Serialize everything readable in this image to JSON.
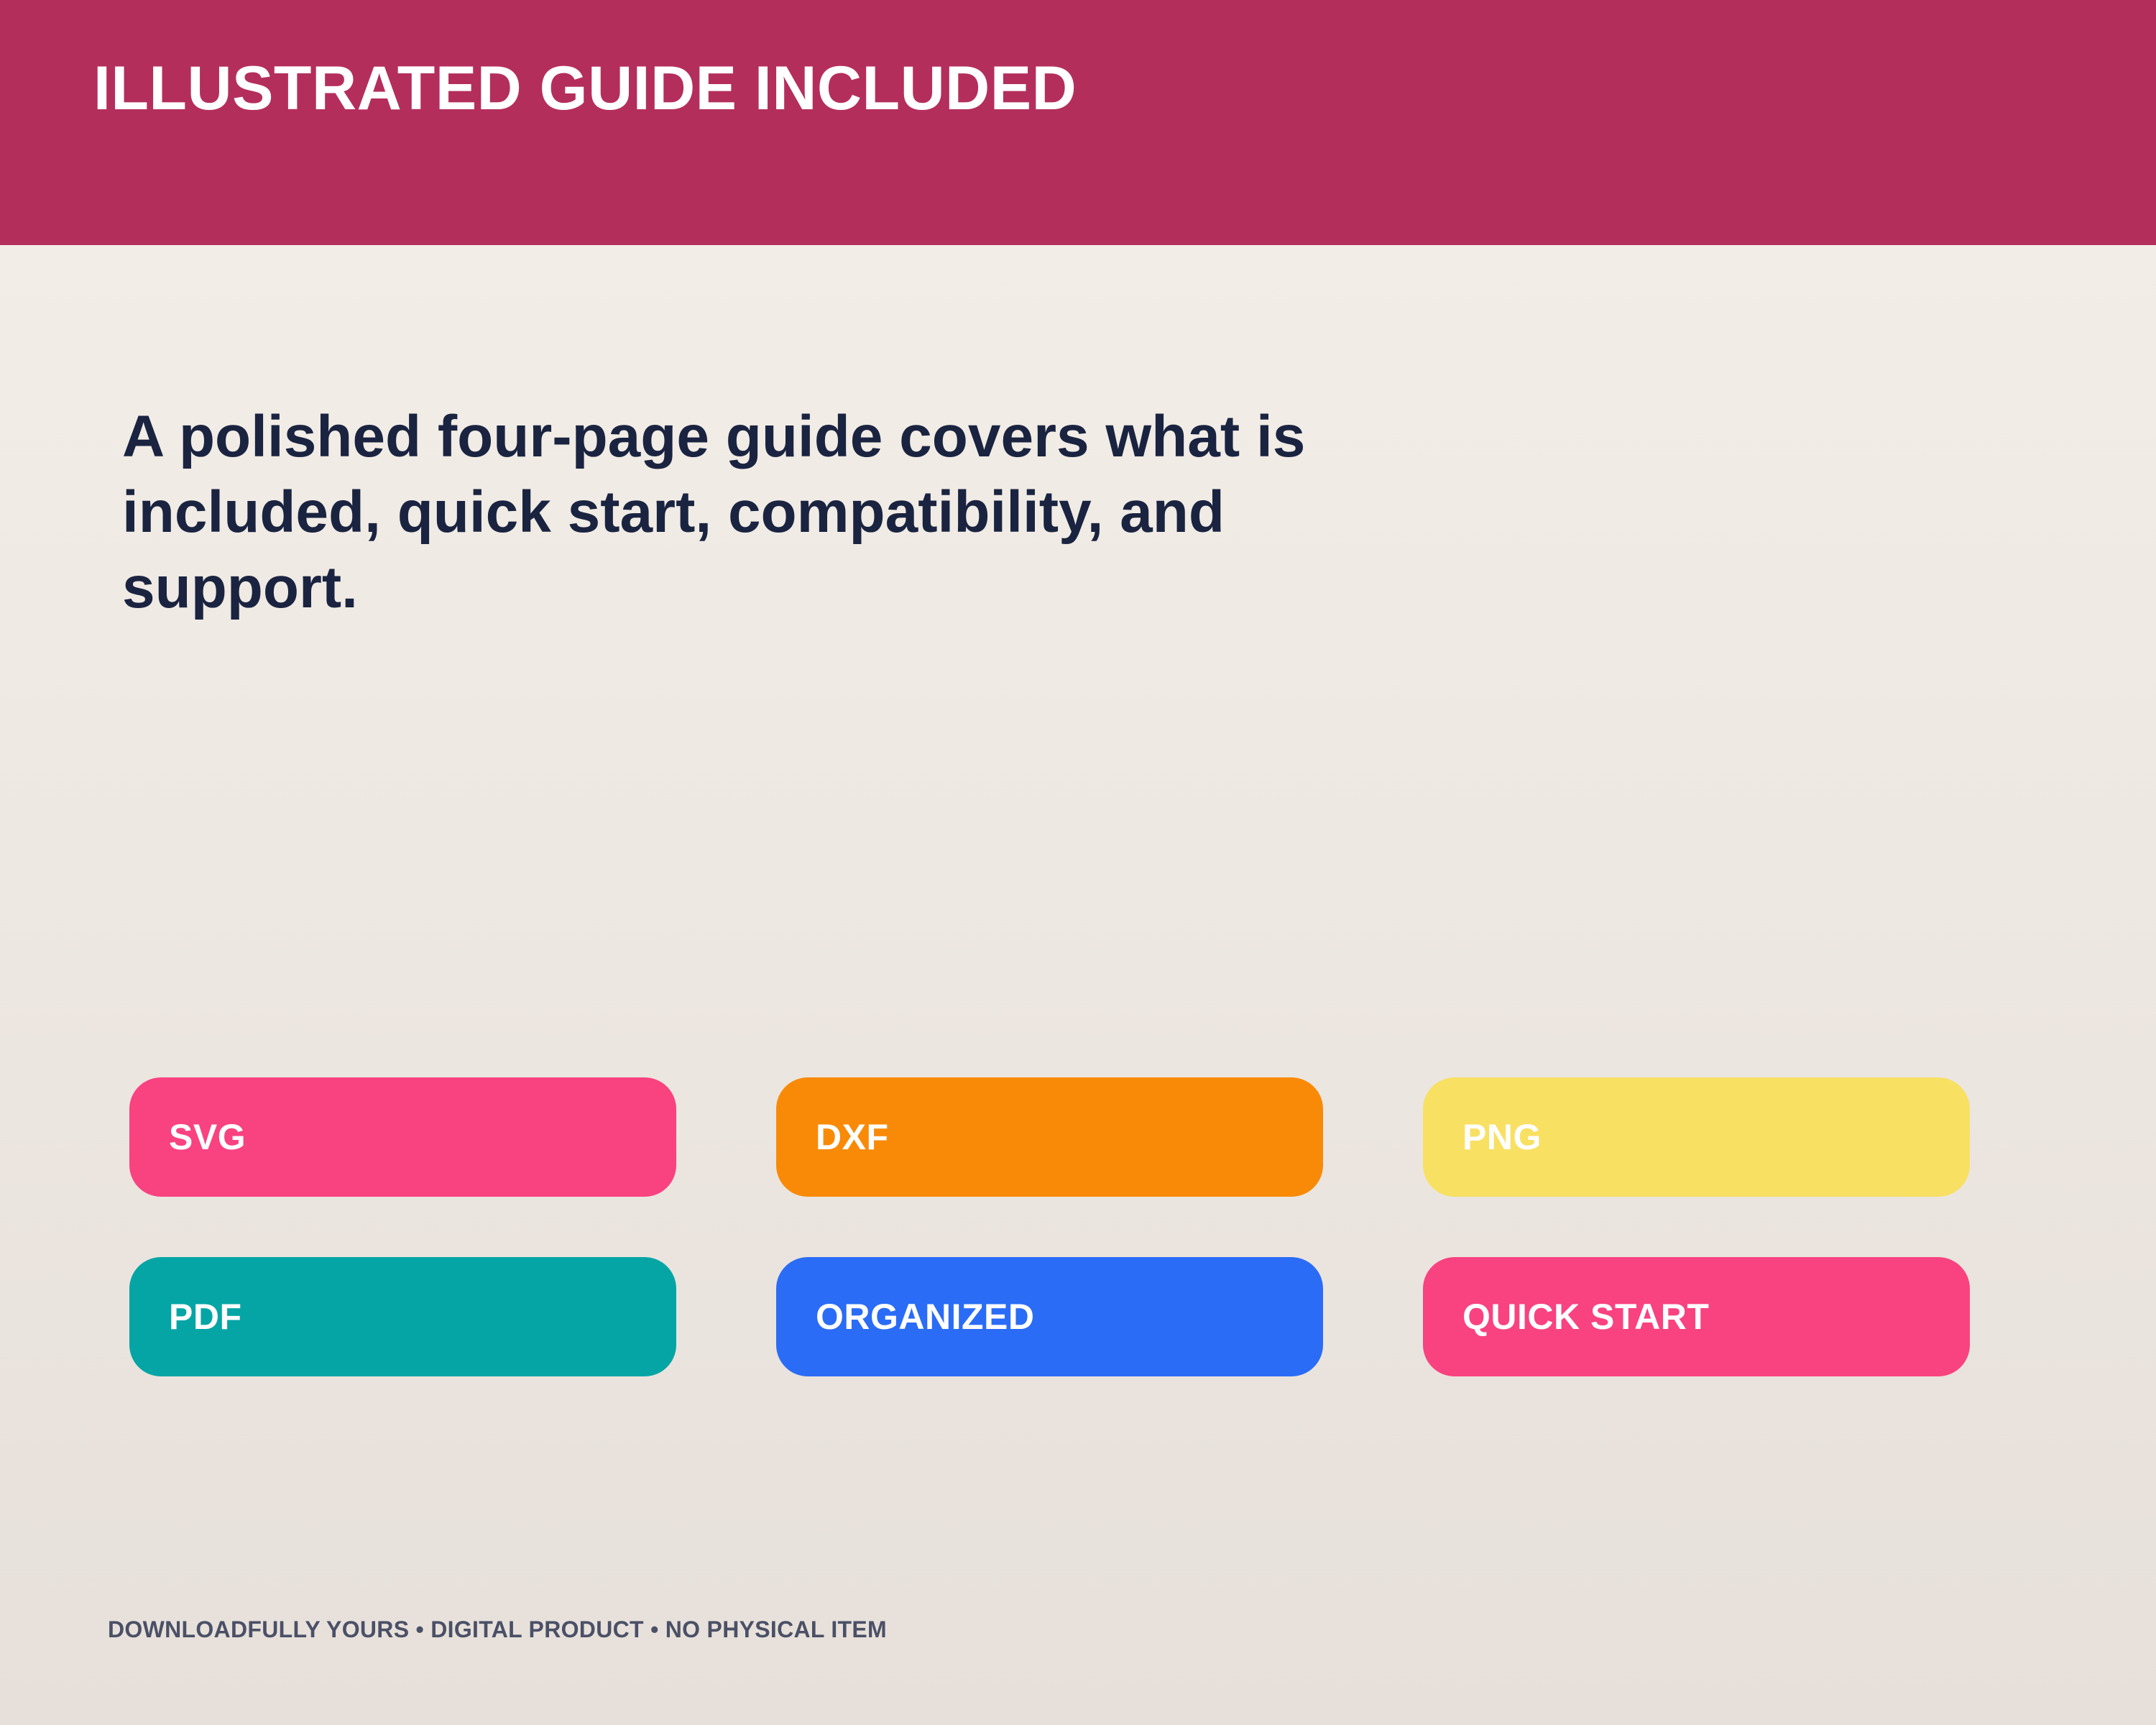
{
  "header": {
    "title": "ILLUSTRATED GUIDE INCLUDED",
    "background_color": "#B42E5C"
  },
  "main": {
    "headline": "A polished four-page guide covers what is included, quick start, compatibility, and support."
  },
  "tags": [
    {
      "label": "SVG",
      "color": "#F94280"
    },
    {
      "label": "DXF",
      "color": "#F98A08"
    },
    {
      "label": "PNG",
      "color": "#F8E063"
    },
    {
      "label": "PDF",
      "color": "#05A5A5"
    },
    {
      "label": "ORGANIZED",
      "color": "#2A6CF6"
    },
    {
      "label": "QUICK START",
      "color": "#F94280"
    }
  ],
  "footer": {
    "text": "DOWNLOADFULLY YOURS • DIGITAL PRODUCT • NO PHYSICAL ITEM"
  }
}
